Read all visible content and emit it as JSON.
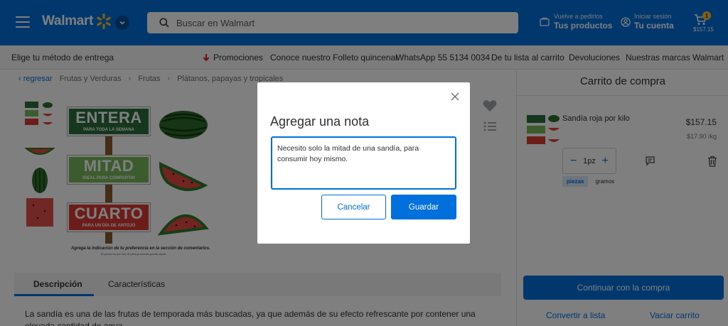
{
  "header": {
    "logo": "Walmart",
    "search_placeholder": "Buscar en Walmart",
    "orders_small": "Vuelve a pedirlos",
    "orders_big": "Tus productos",
    "account_small": "Iniciar sesión",
    "account_big": "Tu cuenta",
    "cart_count": "1",
    "cart_total": "$157.15"
  },
  "subnav": {
    "delivery": "Elige tu método de entrega",
    "promos": "Promociones",
    "flyer": "Conoce nuestro Folleto quincenal",
    "whatsapp": "WhatsApp 55 5134 0034",
    "list_to_cart": "De tu lista al carrito",
    "returns": "Devoluciones",
    "brands": "Nuestras marcas Walmart"
  },
  "breadcrumb": {
    "back": "regresar",
    "items": [
      "Frutas y Verduras",
      "Frutas",
      "Plátanos, papayas y tropicales"
    ]
  },
  "product_image": {
    "sign1_big": "ENTERA",
    "sign1_small": "PARA TODA LA SEMANA",
    "sign2_big": "MITAD",
    "sign2_small": "IDEAL PARA COMPARTIR",
    "sign3_big": "CUARTO",
    "sign3_small": "PARA UN DÍA DE ANTOJO",
    "footnote": "Agrega la indicación de tu preferencia en la sección de comentarios.",
    "footnote2": "El precio es por kilo, el peso promedio puede variar."
  },
  "tabs": {
    "description": "Descripción",
    "features": "Características"
  },
  "description_text": "La sandía es una de las frutas de temporada más buscadas, ya que además de su efecto refrescante por contener una elevada cantidad de agua...",
  "cart": {
    "title": "Carrito de compra",
    "item_name": "Sandía roja por kilo",
    "item_price": "$157.15",
    "item_unit_price": "$17.90 /kg",
    "qty": "1pz",
    "unit_pieces": "piezas",
    "unit_grams": "gramos",
    "continue": "Continuar con la compra",
    "to_list": "Convertir a lista",
    "empty": "Vaciar carrito"
  },
  "modal": {
    "title": "Agregar una nota",
    "note_value": "Necesito solo la mitad de una sandía, para consumir hoy mismo.",
    "cancel": "Cancelar",
    "save": "Guardar"
  },
  "colors": {
    "brand_blue": "#0071dc",
    "spark_yellow": "#ffc220"
  }
}
